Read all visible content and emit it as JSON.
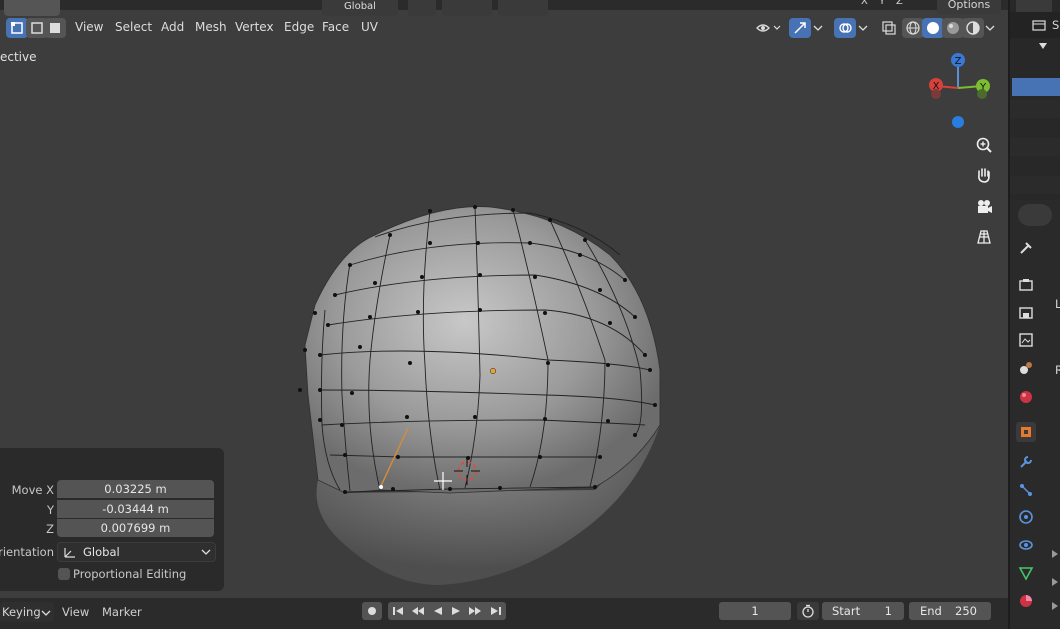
{
  "header": {
    "menus": [
      "View",
      "Select",
      "Add",
      "Mesh",
      "Vertex",
      "Edge",
      "Face",
      "UV"
    ],
    "transform_orientation": "Global",
    "axis_x": "X",
    "axis_y": "Y",
    "axis_z": "Z",
    "options_label": "Options"
  },
  "viewport": {
    "view_label": "ective"
  },
  "gizmo": {
    "x": "X",
    "y": "Y",
    "z": "Z"
  },
  "operator_panel": {
    "move_x_label": "Move X",
    "move_x_value": "0.03225 m",
    "y_label": "Y",
    "y_value": "-0.03444 m",
    "z_label": "Z",
    "z_value": "0.007699 m",
    "orientation_label": "rientation",
    "orientation_value": "Global",
    "proportional_label": "Proportional Editing"
  },
  "timeline": {
    "keying_label": "Keying",
    "view_label": "View",
    "marker_label": "Marker",
    "current_frame": "1",
    "start_label": "Start",
    "start_value": "1",
    "end_label": "End",
    "end_value": "250"
  },
  "outliner": {
    "s_label": "S"
  },
  "properties": {
    "l_label": "L",
    "r_label": "R"
  },
  "colors": {
    "accent": "#4772b3",
    "viewport_bg": "#3d3d3d"
  }
}
